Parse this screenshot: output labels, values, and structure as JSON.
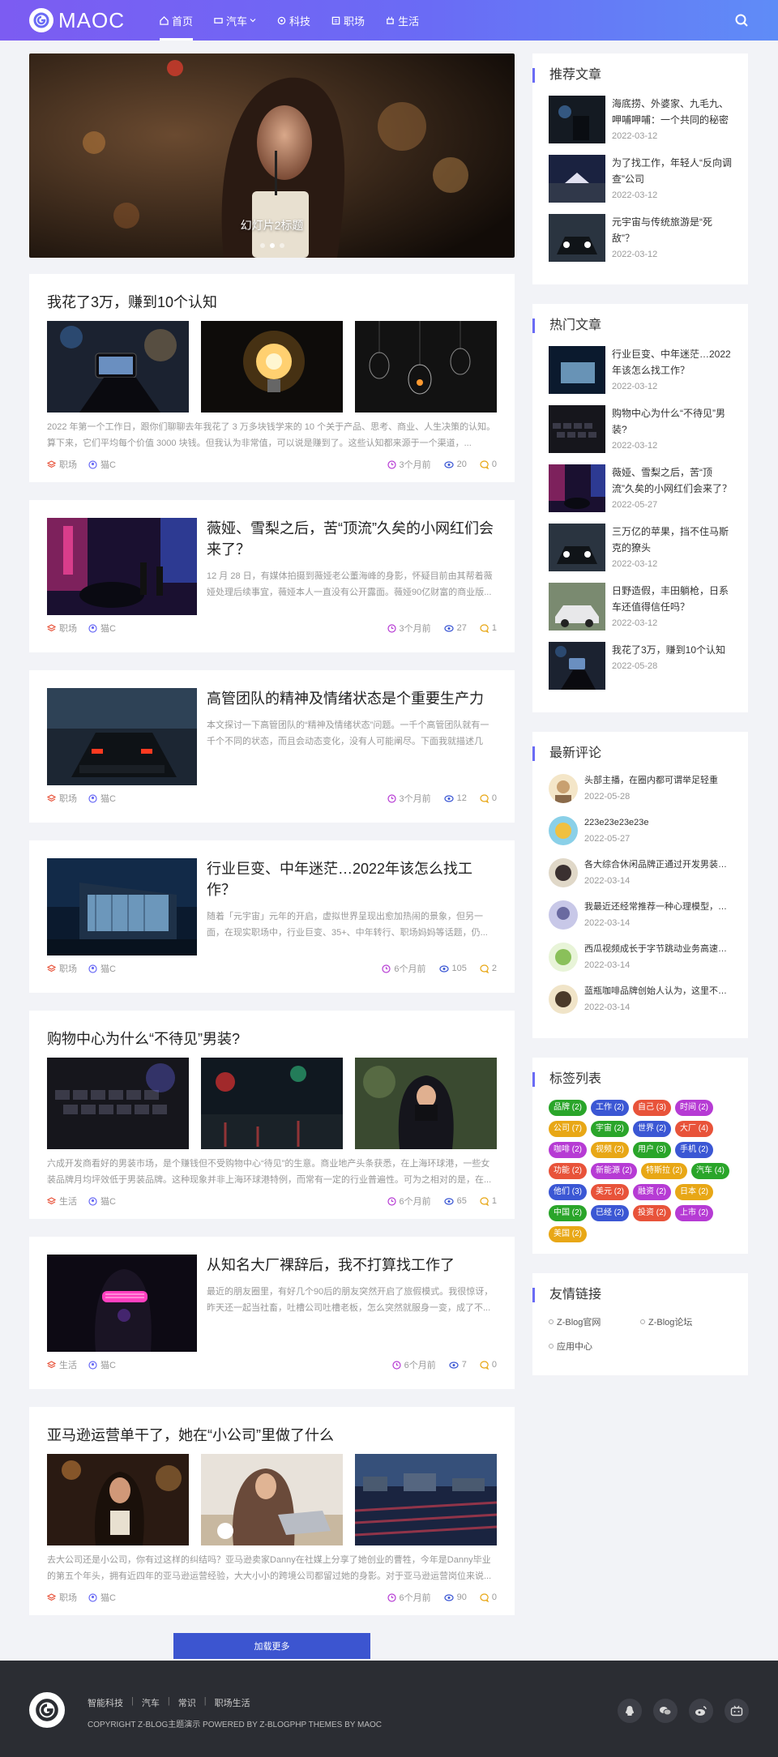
{
  "header": {
    "logo_text": "MAOC",
    "nav": [
      {
        "label": "首页",
        "icon": "home-icon",
        "active": true
      },
      {
        "label": "汽车",
        "icon": "car-icon",
        "dropdown": true
      },
      {
        "label": "科技",
        "icon": "chip-icon"
      },
      {
        "label": "职场",
        "icon": "briefcase-icon"
      },
      {
        "label": "生活",
        "icon": "cup-icon"
      }
    ]
  },
  "slider": {
    "caption": "幻灯片2标题"
  },
  "posts": [
    {
      "title": "我花了3万，赚到10个认知",
      "layout": "triple",
      "excerpt": "2022 年第一个工作日，跟你们聊聊去年我花了 3 万多块钱学来的 10 个关于产品、思考、商业、人生决策的认知。算下来，它们平均每个价值 3000 块钱。但我认为非常值，可以说是赚到了。这些认知都来源于一个渠道，...",
      "category": "职场",
      "author": "猫C",
      "time": "3个月前",
      "views": "20",
      "comments": "0"
    },
    {
      "title": "薇娅、雪梨之后，苦“顶流”久矣的小网红们会来了？",
      "layout": "single",
      "excerpt": "12 月 28 日，有媒体拍摄到薇娅老公董海峰的身影，怀疑目前由其帮着薇娅处理后续事宜，薇娅本人一直没有公开露面。薇娅90亿财富的商业版...",
      "category": "职场",
      "author": "猫C",
      "time": "3个月前",
      "views": "27",
      "comments": "1"
    },
    {
      "title": "高管团队的精神及情绪状态是个重要生产力",
      "layout": "single",
      "excerpt": "本文探讨一下高管团队的“精神及情绪状态”问题。一千个高管团队就有一千个不同的状态，而且会动态变化，没有人可能阐尽。下面我就描述几几...",
      "category": "职场",
      "author": "猫C",
      "time": "3个月前",
      "views": "12",
      "comments": "0"
    },
    {
      "title": "行业巨变、中年迷茫…2022年该怎么找工作？",
      "layout": "single",
      "excerpt": "随着「元宇宙」元年的开启，虚拟世界呈现出愈加热闹的景象，但另一面，在现实职场中，行业巨变、35+、中年转行、职场妈妈等话题，仍...",
      "category": "职场",
      "author": "猫C",
      "time": "6个月前",
      "views": "105",
      "comments": "2"
    },
    {
      "title": "购物中心为什么“不待见”男装?",
      "layout": "triple",
      "excerpt": "六成开发商看好的男装市场，是个赚钱但不受购物中心“待见”的生意。商业地产头条获悉，在上海环球港，一些女装品牌月均坪效低于男装品牌。这种现象并非上海环球港特例，而常有一定的行业普遍性。可为之相对的是，在...",
      "category": "生活",
      "author": "猫C",
      "time": "6个月前",
      "views": "65",
      "comments": "1"
    },
    {
      "title": "从知名大厂裸辞后，我不打算找工作了",
      "layout": "single",
      "excerpt": "最近的朋友圈里，有好几个90后的朋友突然开启了旅假模式。我很惊讶，昨天还一起当社畜，吐槽公司吐槽老板，怎么突然就服身一变，成了不...",
      "category": "生活",
      "author": "猫C",
      "time": "6个月前",
      "views": "7",
      "comments": "0"
    },
    {
      "title": "亚马逊运营单干了，她在“小公司”里做了什么",
      "layout": "triple",
      "excerpt": "去大公司还是小公司，你有过这样的纠结吗？亚马逊卖家Danny在社媒上分享了她创业的曹牲，今年是Danny毕业的第五个年头，拥有近四年的亚马逊运营经验，大大小小的跨境公司都留过她的身影。对于亚马逊运营岗位来说...",
      "category": "职场",
      "author": "猫C",
      "time": "6个月前",
      "views": "90",
      "comments": "0"
    }
  ],
  "load_more": "加载更多",
  "sidebar": {
    "recommended": {
      "title": "推荐文章",
      "items": [
        {
          "title": "海底捞、外婆家、九毛九、呷哺呷哺：一个共同的秘密",
          "date": "2022-03-12"
        },
        {
          "title": "为了找工作，年轻人“反向调查”公司",
          "date": "2022-03-12"
        },
        {
          "title": "元宇宙与传统旅游是“死敌”？",
          "date": "2022-03-12"
        }
      ]
    },
    "hot": {
      "title": "热门文章",
      "items": [
        {
          "title": "行业巨变、中年迷茫…2022年该怎么找工作？",
          "date": "2022-03-12"
        },
        {
          "title": "购物中心为什么“不待见”男装?",
          "date": "2022-03-12"
        },
        {
          "title": "薇娅、雪梨之后，苦“顶流”久矣的小网红们会来了？",
          "date": "2022-05-27"
        },
        {
          "title": "三万亿的苹果，挡不住马斯克的獠头",
          "date": "2022-03-12"
        },
        {
          "title": "日野造假，丰田躺枪，日系车还值得信任吗？",
          "date": "2022-03-12"
        },
        {
          "title": "我花了3万，赚到10个认知",
          "date": "2022-05-28"
        }
      ]
    },
    "comments": {
      "title": "最新评论",
      "items": [
        {
          "text": "头部主播，在圈内都可谓举足轻重",
          "date": "2022-05-28"
        },
        {
          "text": "223e23e23e23e",
          "date": "2022-05-27"
        },
        {
          "text": "各大综合休闲品牌正通过开发男装条线，完善产品结构",
          "date": "2022-03-14"
        },
        {
          "text": "我最近还经常推荐一种心理模型，但是说起来一言难尽",
          "date": "2022-03-14"
        },
        {
          "text": "西瓜视频成长于字节跳动业务高速发展时期",
          "date": "2022-03-14"
        },
        {
          "text": "蓝瓶咖啡品牌创始人认为，这里不是咖啡的天堂",
          "date": "2022-03-14"
        }
      ]
    },
    "tags": {
      "title": "标签列表",
      "items": [
        {
          "label": "品牌 (2)",
          "color": "#2aa52a"
        },
        {
          "label": "工作 (2)",
          "color": "#3b57d4"
        },
        {
          "label": "自己 (3)",
          "color": "#e8533a"
        },
        {
          "label": "时间 (2)",
          "color": "#b63bd4"
        },
        {
          "label": "公司 (7)",
          "color": "#e8a716"
        },
        {
          "label": "宇宙 (2)",
          "color": "#2aa52a"
        },
        {
          "label": "世界 (2)",
          "color": "#3b57d4"
        },
        {
          "label": "大厂 (4)",
          "color": "#e8533a"
        },
        {
          "label": "咖啡 (2)",
          "color": "#b63bd4"
        },
        {
          "label": "视频 (2)",
          "color": "#e8a716"
        },
        {
          "label": "用户 (3)",
          "color": "#2aa52a"
        },
        {
          "label": "手机 (2)",
          "color": "#3b57d4"
        },
        {
          "label": "功能 (2)",
          "color": "#e8533a"
        },
        {
          "label": "新能源 (2)",
          "color": "#b63bd4"
        },
        {
          "label": "特斯拉 (2)",
          "color": "#e8a716"
        },
        {
          "label": "汽车 (4)",
          "color": "#2aa52a"
        },
        {
          "label": "他们 (3)",
          "color": "#3b57d4"
        },
        {
          "label": "美元 (2)",
          "color": "#e8533a"
        },
        {
          "label": "融资 (2)",
          "color": "#b63bd4"
        },
        {
          "label": "日本 (2)",
          "color": "#e8a716"
        },
        {
          "label": "中国 (2)",
          "color": "#2aa52a"
        },
        {
          "label": "已经 (2)",
          "color": "#3b57d4"
        },
        {
          "label": "投资 (2)",
          "color": "#e8533a"
        },
        {
          "label": "上市 (2)",
          "color": "#b63bd4"
        },
        {
          "label": "美国 (2)",
          "color": "#e8a716"
        }
      ]
    },
    "links": {
      "title": "友情链接",
      "items": [
        "Z-Blog官网",
        "Z-Blog论坛",
        "应用中心"
      ]
    }
  },
  "footer": {
    "links": [
      "智能科技",
      "汽车",
      "常识",
      "职场生活"
    ],
    "copyright": "COPYRIGHT Z-BLOG主题演示 POWERED BY Z-BLOGPHP THEMES BY MAOC",
    "icons": [
      "qq-icon",
      "wechat-icon",
      "weibo-icon",
      "bilibili-icon"
    ]
  }
}
